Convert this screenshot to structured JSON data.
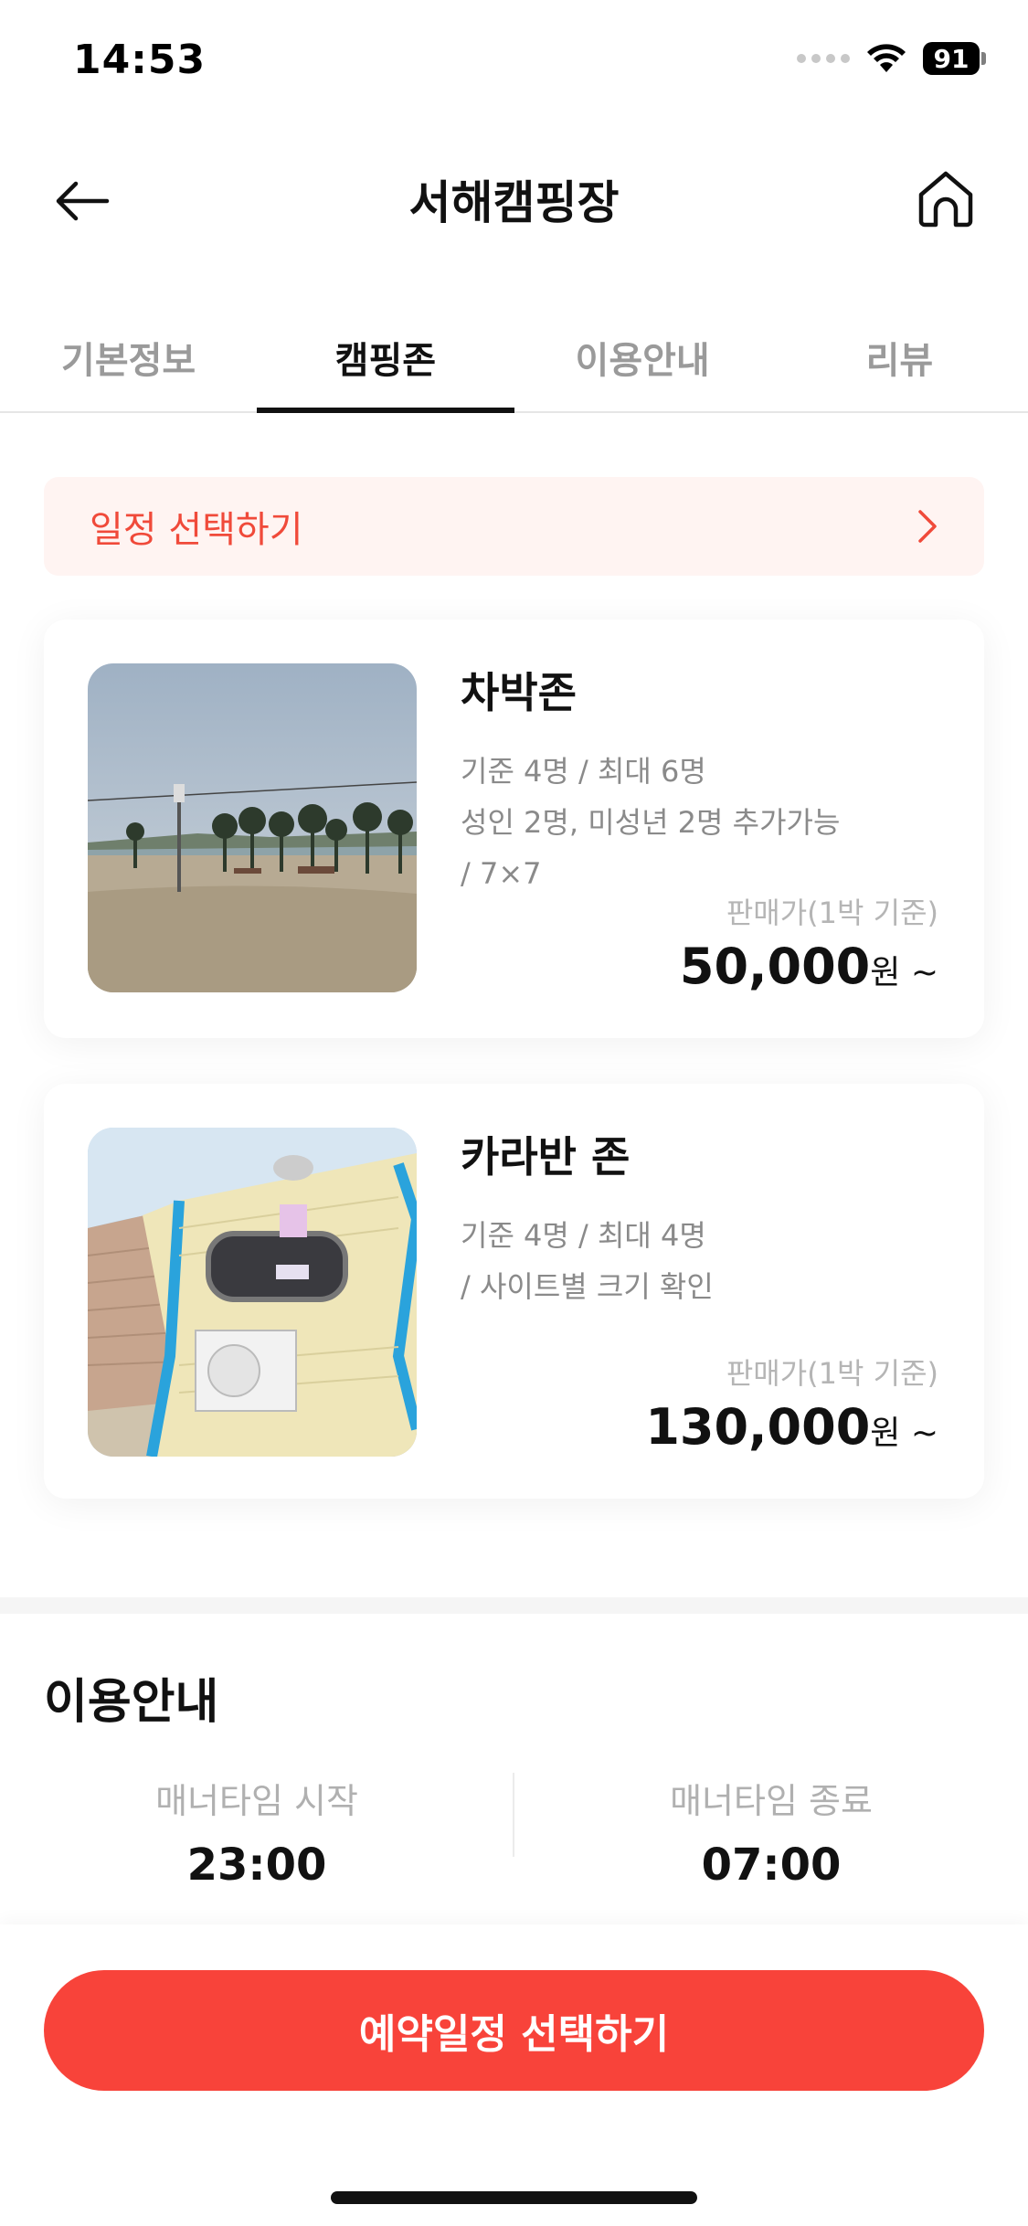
{
  "status": {
    "time": "14:53",
    "battery": "91"
  },
  "nav": {
    "title": "서해캠핑장",
    "back_icon": "arrow-left-icon",
    "home_icon": "home-icon"
  },
  "tabs": [
    {
      "label": "기본정보",
      "active": false
    },
    {
      "label": "캠핑존",
      "active": true
    },
    {
      "label": "이용안내",
      "active": false
    },
    {
      "label": "리뷰",
      "active": false
    }
  ],
  "schedule": {
    "label": "일정 선택하기"
  },
  "zones": [
    {
      "title": "차박존",
      "lines": [
        "기준 4명 / 최대 6명",
        "성인 2명, 미성년 2명 추가가능",
        "/ 7×7"
      ],
      "price_label": "판매가(1박 기준)",
      "price": "50,000",
      "price_unit": "원 ~"
    },
    {
      "title": "카라반 존",
      "lines": [
        "기준 4명 / 최대 4명",
        "/ 사이트별 크기 확인"
      ],
      "price_label": "판매가(1박 기준)",
      "price": "130,000",
      "price_unit": "원 ~"
    }
  ],
  "info": {
    "title": "이용안내",
    "manner_start_label": "매너타임 시작",
    "manner_start": "23:00",
    "manner_end_label": "매너타임 종료",
    "manner_end": "07:00"
  },
  "cta": {
    "label": "예약일정 선택하기"
  },
  "colors": {
    "accent": "#f8433a",
    "accent_soft": "#fff4f2"
  }
}
